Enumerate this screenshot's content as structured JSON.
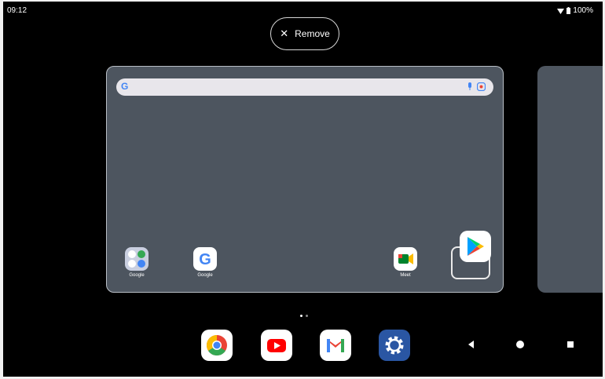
{
  "status": {
    "time": "09:12",
    "battery": "100%"
  },
  "remove_button": {
    "label": "Remove",
    "icon": "close-icon"
  },
  "home": {
    "apps": [
      {
        "label": "Google",
        "icon": "folder-icon"
      },
      {
        "label": "Google",
        "icon": "google-icon"
      },
      {
        "label": "Meet",
        "icon": "meet-icon"
      }
    ],
    "dragging_app": {
      "icon": "play-store-icon"
    }
  },
  "dock": [
    "chrome-icon",
    "youtube-icon",
    "gmail-icon",
    "settings-icon"
  ],
  "nav": [
    "back-button",
    "home-button",
    "recents-button"
  ]
}
